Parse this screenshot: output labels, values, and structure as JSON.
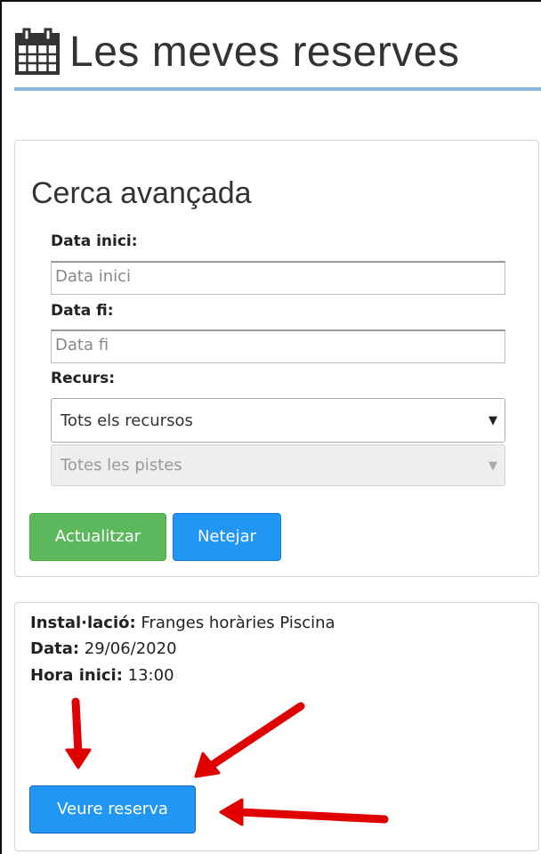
{
  "header": {
    "title": "Les meves reserves",
    "icon": "calendar-icon"
  },
  "search": {
    "title": "Cerca avançada",
    "start_date_label": "Data inici:",
    "start_date_placeholder": "Data inici",
    "start_date_value": "",
    "end_date_label": "Data fi:",
    "end_date_placeholder": "Data fi",
    "end_date_value": "",
    "resource_label": "Recurs:",
    "resource_selected": "Tots els recursos",
    "tracks_selected": "Totes les pistes",
    "update_label": "Actualitzar",
    "clear_label": "Netejar"
  },
  "booking": {
    "installation_label": "Instal·lació:",
    "installation_value": "Franges horàries Piscina",
    "date_label": "Data:",
    "date_value": "29/06/2020",
    "start_time_label": "Hora inici:",
    "start_time_value": "13:00",
    "view_label": "Veure reserva"
  },
  "colors": {
    "accent_blue": "#2196f3",
    "accent_green": "#5cb85c",
    "header_underline": "#8ab7df",
    "annotation_red": "#e00000"
  }
}
